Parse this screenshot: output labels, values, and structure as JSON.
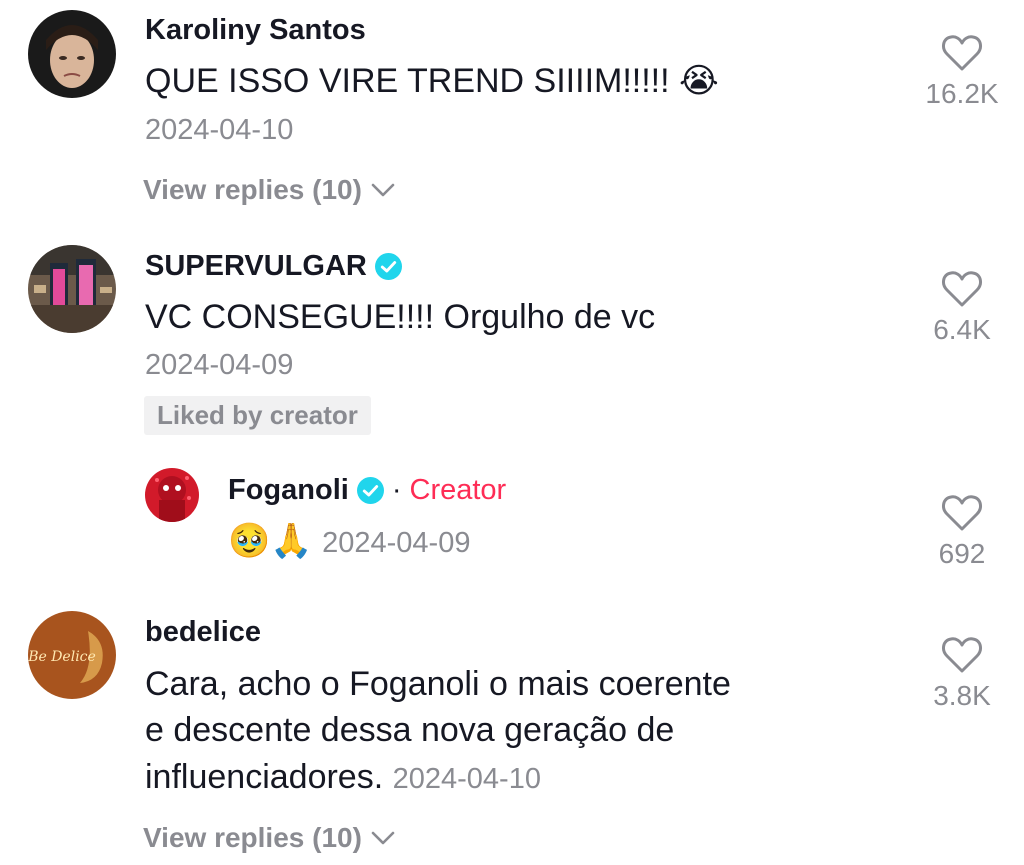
{
  "comments": [
    {
      "username": "Karoliny Santos",
      "text": "QUE ISSO VIRE TREND SIIIIM!!!!! 😭",
      "date": "2024-04-10",
      "likes": "16.2K",
      "replies_label": "View replies (10)"
    },
    {
      "username": "SUPERVULGAR",
      "text": "VC CONSEGUE!!!! Orgulho de vc",
      "date": "2024-04-09",
      "likes": "6.4K",
      "liked_by_creator": "Liked by creator",
      "reply": {
        "username": "Foganoli",
        "separator": "·",
        "creator_label": "Creator",
        "emojis": "🥹🙏",
        "date": "2024-04-09",
        "likes": "692"
      }
    },
    {
      "username": "bedelice",
      "text_lines": [
        "Cara, acho o Foganoli o mais coerente",
        "e descente dessa nova geração de",
        "influenciadores."
      ],
      "date": "2024-04-10",
      "likes": "3.8K",
      "replies_label": "View replies (10)",
      "avatar_text": "Be Delice"
    }
  ],
  "colors": {
    "verified": "#20d5ec",
    "creator": "#fe2c55",
    "secondary_text": "#8a8b91"
  }
}
